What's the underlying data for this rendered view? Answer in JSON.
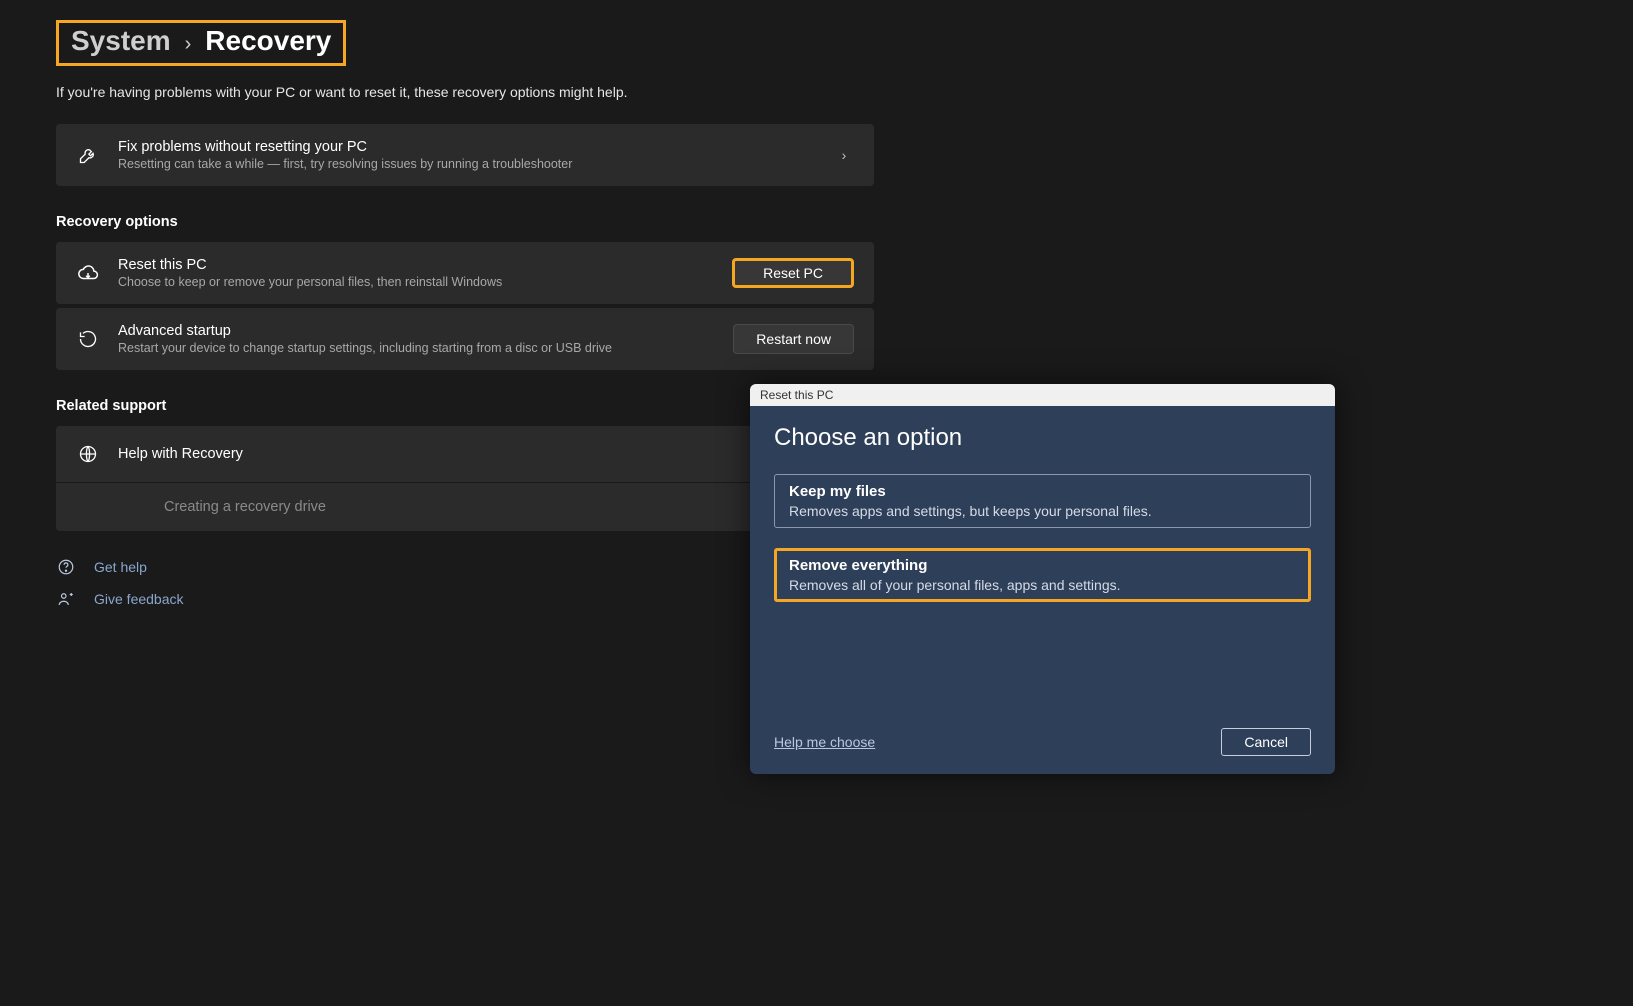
{
  "breadcrumb": {
    "parent": "System",
    "current": "Recovery"
  },
  "subtitle": "If you're having problems with your PC or want to reset it, these recovery options might help.",
  "troubleshoot": {
    "title": "Fix problems without resetting your PC",
    "desc": "Resetting can take a while — first, try resolving issues by running a troubleshooter"
  },
  "sections": {
    "recovery_options": "Recovery options",
    "related_support": "Related support"
  },
  "reset_pc": {
    "title": "Reset this PC",
    "desc": "Choose to keep or remove your personal files, then reinstall Windows",
    "button": "Reset PC"
  },
  "advanced": {
    "title": "Advanced startup",
    "desc": "Restart your device to change startup settings, including starting from a disc or USB drive",
    "button": "Restart now"
  },
  "help_recovery": {
    "title": "Help with Recovery",
    "recovery_drive": "Creating a recovery drive"
  },
  "footer": {
    "get_help": "Get help",
    "give_feedback": "Give feedback"
  },
  "dialog": {
    "titlebar": "Reset this PC",
    "heading": "Choose an option",
    "keep": {
      "title": "Keep my files",
      "desc": "Removes apps and settings, but keeps your personal files."
    },
    "remove": {
      "title": "Remove everything",
      "desc": "Removes all of your personal files, apps and settings."
    },
    "help_link": "Help me choose",
    "cancel": "Cancel"
  }
}
